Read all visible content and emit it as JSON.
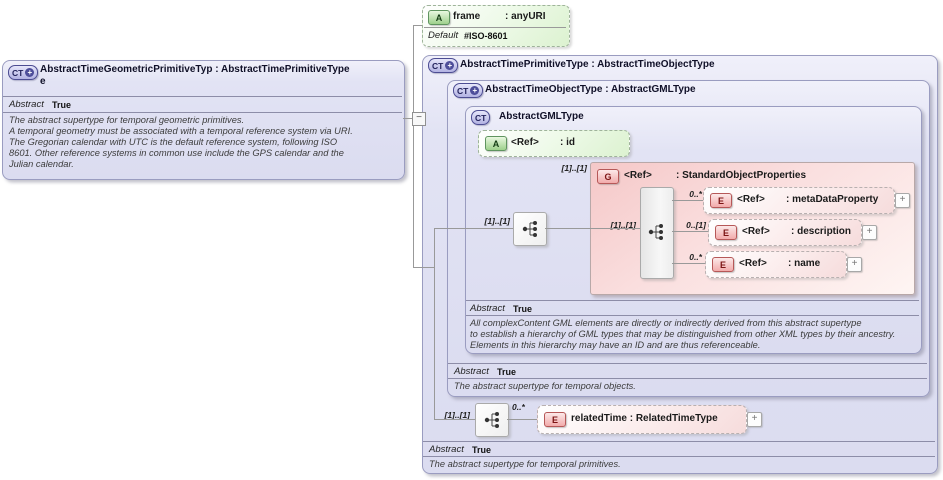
{
  "icons": {
    "ct": "CT",
    "plus_badge": "+",
    "a": "A",
    "e": "E",
    "g": "G",
    "expand": "+",
    "collapse": "−"
  },
  "frame_attr": {
    "name": "frame",
    "type": ": anyURI",
    "default_label": "Default",
    "default_value": "#ISO-8601"
  },
  "left_type": {
    "title_line1": "AbstractTimeGeometricPrimitiveTyp : AbstractTimePrimitiveType",
    "title_line2": "e",
    "abstract_label": "Abstract",
    "abstract_value": "True",
    "doc": "The abstract supertype for temporal geometric primitives.\nA temporal geometry must be associated with a temporal reference system via URI.\nThe Gregorian calendar with UTC is the default reference system, following ISO\n8601. Other reference systems in common use include the GPS calendar and the\nJulian calendar."
  },
  "time_primitive": {
    "title": "AbstractTimePrimitiveType : AbstractTimeObjectType",
    "abstract_label": "Abstract",
    "abstract_value": "True",
    "doc": "The abstract supertype for temporal primitives."
  },
  "time_object": {
    "title": "AbstractTimeObjectType : AbstractGMLType",
    "abstract_label": "Abstract",
    "abstract_value": "True",
    "doc": "The abstract supertype for temporal objects."
  },
  "gml_type": {
    "title": "AbstractGMLType",
    "abstract_label": "Abstract",
    "abstract_value": "True",
    "doc": "All complexContent GML elements are directly or indirectly derived from this abstract supertype\nto establish a hierarchy of GML types that may be distinguished from other XML types by their ancestry.\nElements in this hierarchy may have an ID and are thus referenceable.",
    "id_attr": {
      "name": "<Ref>",
      "type": ": id"
    },
    "compositor_card": "[1]..[1]"
  },
  "group": {
    "ref_card": "[1]..[1]",
    "name": "<Ref>",
    "type": ": StandardObjectProperties",
    "inner_card": "[1]..[1]",
    "children": [
      {
        "card": "0..*",
        "name": "<Ref>",
        "type": ": metaDataProperty"
      },
      {
        "card": "0..[1]",
        "name": "<Ref>",
        "type": ": description"
      },
      {
        "card": "0..*",
        "name": "<Ref>",
        "type": ": name"
      }
    ]
  },
  "related_time": {
    "compositor_card": "[1]..[1]",
    "occurs": "0..*",
    "label": "relatedTime : RelatedTimeType"
  }
}
